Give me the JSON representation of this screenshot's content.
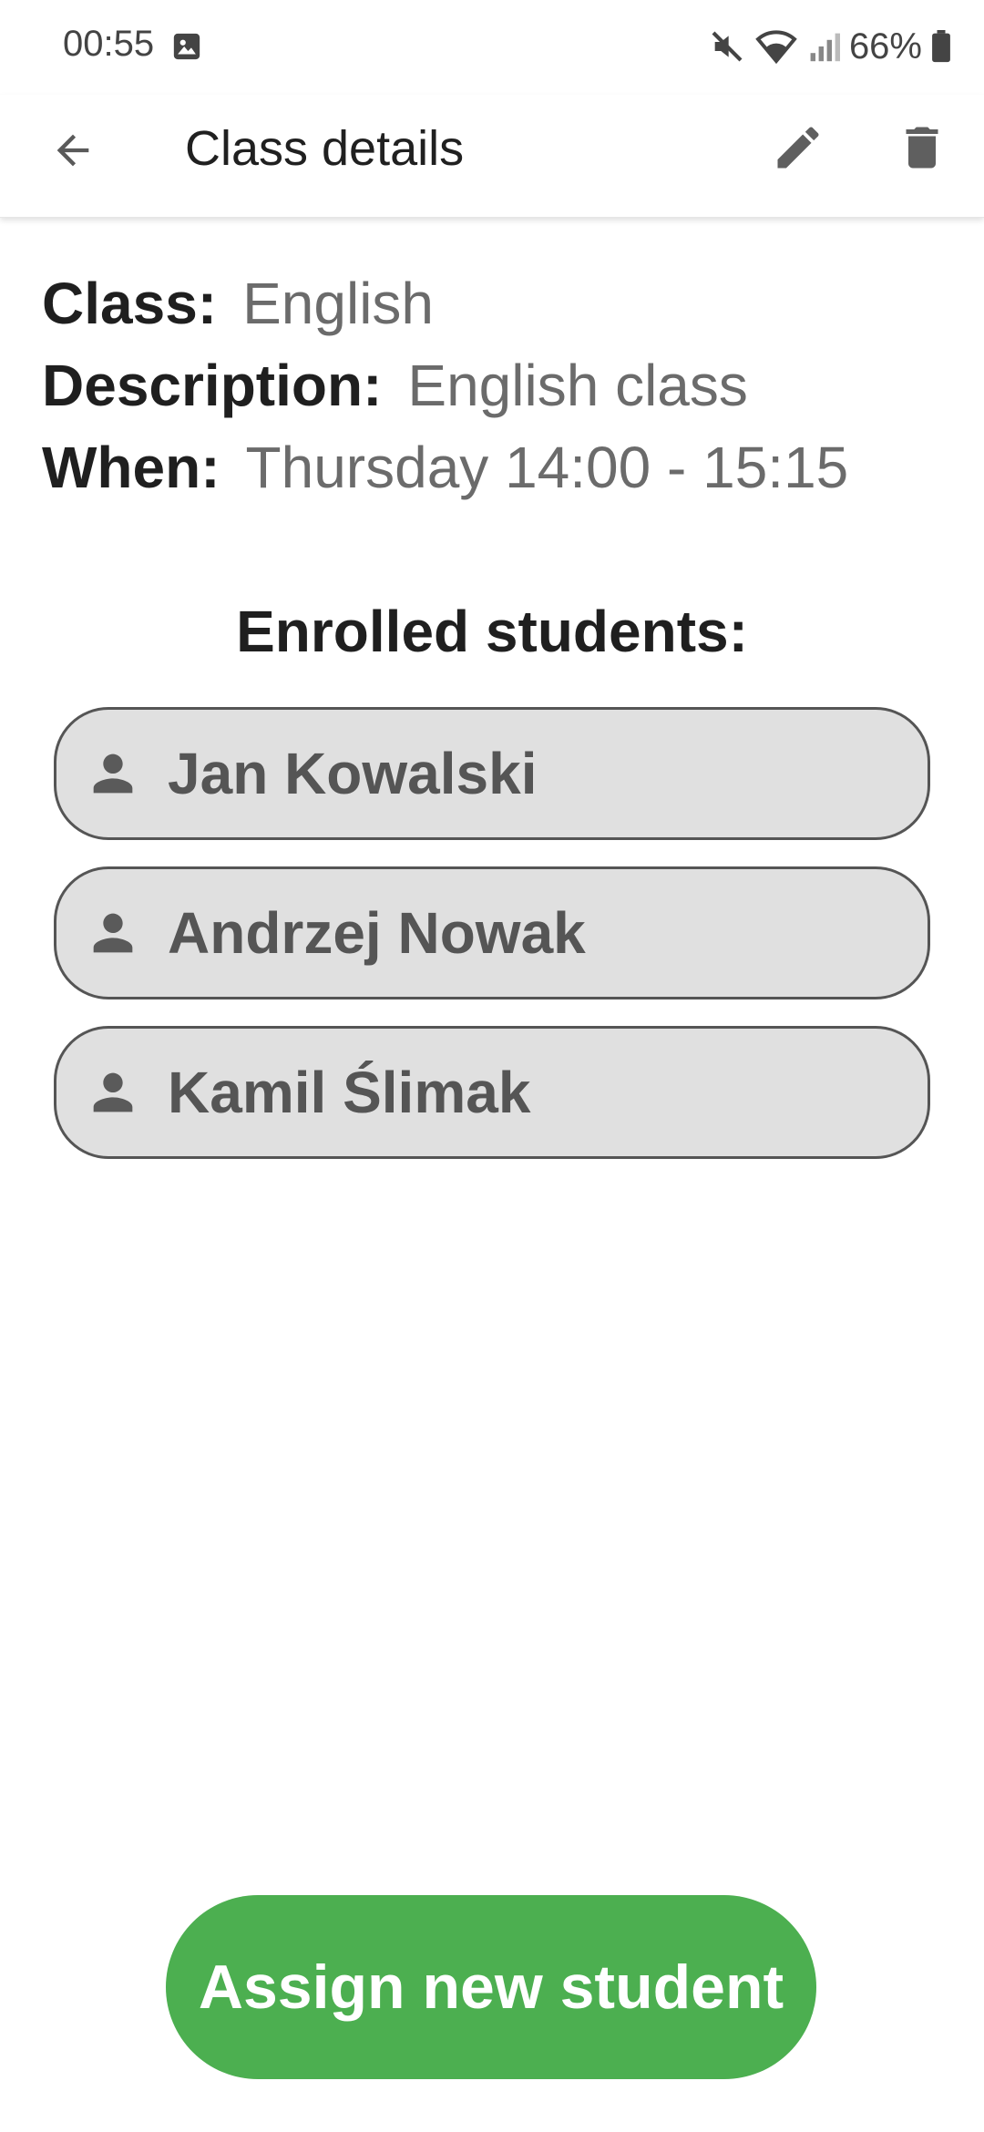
{
  "status_bar": {
    "time": "00:55",
    "battery": "66%"
  },
  "app_bar": {
    "title": "Class details"
  },
  "details": {
    "class_label": "Class:",
    "class_value": "English",
    "description_label": "Description:",
    "description_value": "English class",
    "when_label": "When:",
    "when_value": "Thursday 14:00 - 15:15"
  },
  "students": {
    "title": "Enrolled students:",
    "items": [
      {
        "name": "Jan Kowalski"
      },
      {
        "name": "Andrzej Nowak"
      },
      {
        "name": "Kamil Ślimak"
      }
    ]
  },
  "actions": {
    "assign_label": "Assign new student"
  },
  "colors": {
    "accent": "#4caf50",
    "icon": "#5f5f5f",
    "chip_bg": "#e0e0e0"
  },
  "icons": {
    "back": "arrow-back-icon",
    "edit": "pencil-icon",
    "delete": "trash-icon",
    "person": "person-icon",
    "gallery": "gallery-icon",
    "mute": "mute-icon",
    "wifi": "wifi-icon",
    "signal": "signal-icon",
    "battery": "battery-icon"
  }
}
